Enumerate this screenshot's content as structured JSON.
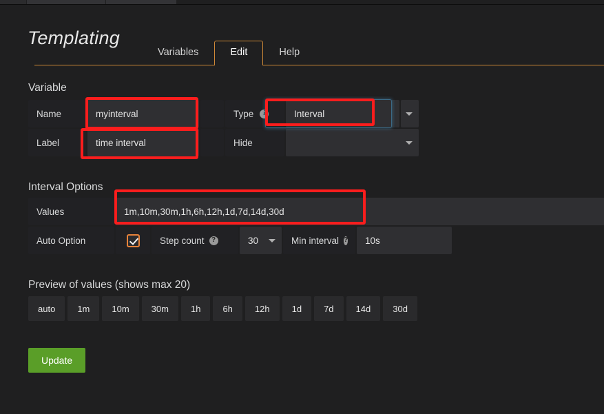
{
  "header": {
    "title": "Templating",
    "tabs": [
      {
        "label": "Variables",
        "active": false
      },
      {
        "label": "Edit",
        "active": true
      },
      {
        "label": "Help",
        "active": false
      }
    ]
  },
  "sections": {
    "variable_title": "Variable",
    "interval_options_title": "Interval Options",
    "preview_title": "Preview of values (shows max 20)"
  },
  "variable": {
    "name_label": "Name",
    "name_value": "myinterval",
    "label_label": "Label",
    "label_value": "time interval",
    "type_label": "Type",
    "type_info_icon": "info-icon",
    "type_value": "Interval",
    "hide_label": "Hide",
    "hide_value": ""
  },
  "interval_options": {
    "values_label": "Values",
    "values_value": "1m,10m,30m,1h,6h,12h,1d,7d,14d,30d",
    "auto_option_label": "Auto Option",
    "auto_option_checked": true,
    "step_count_label": "Step count",
    "step_count_help_icon": "help-icon",
    "step_count_value": "30",
    "min_interval_label": "Min interval",
    "min_interval_help_icon": "help-icon",
    "min_interval_value": "10s"
  },
  "preview": {
    "chips": [
      "auto",
      "1m",
      "10m",
      "30m",
      "1h",
      "6h",
      "12h",
      "1d",
      "7d",
      "14d",
      "30d"
    ]
  },
  "actions": {
    "update_label": "Update"
  },
  "colors": {
    "accent_orange": "#cf8937",
    "annotation_red": "#fb1d1d",
    "update_green": "#5a9e28",
    "checkbox_orange": "#e8833a",
    "page_bg": "#1f1f20",
    "field_bg": "#2f2f32",
    "label_bg": "#212124"
  }
}
